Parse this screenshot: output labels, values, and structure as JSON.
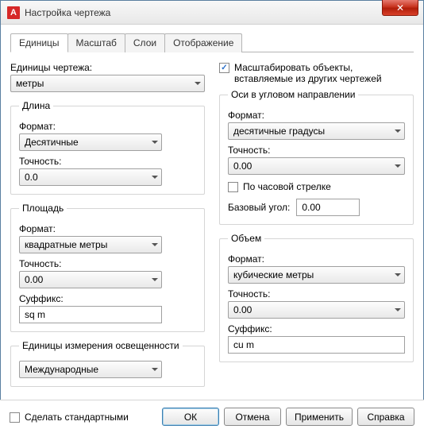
{
  "window": {
    "title": "Настройка чертежа",
    "app_icon_letter": "A"
  },
  "tabs": {
    "units": "Единицы",
    "scale": "Масштаб",
    "layers": "Слои",
    "display": "Отображение"
  },
  "left": {
    "drawing_units_label": "Единицы чертежа:",
    "drawing_units_value": "метры",
    "length": {
      "legend": "Длина",
      "format_label": "Формат:",
      "format_value": "Десятичные",
      "precision_label": "Точность:",
      "precision_value": "0.0"
    },
    "area": {
      "legend": "Площадь",
      "format_label": "Формат:",
      "format_value": "квадратные метры",
      "precision_label": "Точность:",
      "precision_value": "0.00",
      "suffix_label": "Суффикс:",
      "suffix_value": "sq m"
    },
    "lighting": {
      "legend": "Единицы измерения освещенности",
      "value": "Международные"
    }
  },
  "right": {
    "scale_inserted_label": "Масштабировать объекты, вставляемые из других чертежей",
    "angle": {
      "legend": "Оси в угловом направлении",
      "format_label": "Формат:",
      "format_value": "десятичные градусы",
      "precision_label": "Точность:",
      "precision_value": "0.00",
      "clockwise_label": "По часовой стрелке",
      "base_angle_label": "Базовый угол:",
      "base_angle_value": "0.00"
    },
    "volume": {
      "legend": "Объем",
      "format_label": "Формат:",
      "format_value": "кубические метры",
      "precision_label": "Точность:",
      "precision_value": "0.00",
      "suffix_label": "Суффикс:",
      "suffix_value": "cu m"
    }
  },
  "footer": {
    "make_default_label": "Сделать стандартными",
    "ok": "ОК",
    "cancel": "Отмена",
    "apply": "Применить",
    "help": "Справка"
  }
}
